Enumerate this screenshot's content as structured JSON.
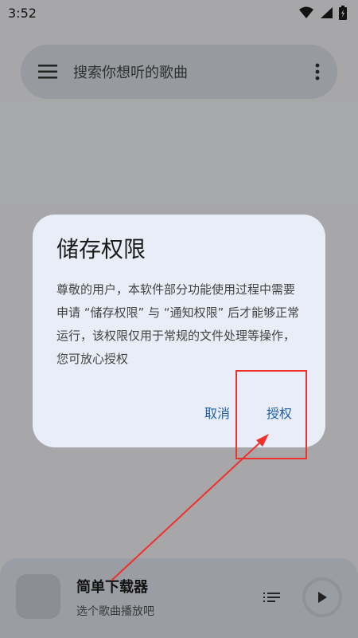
{
  "status_bar": {
    "time": "3:52"
  },
  "search": {
    "placeholder": "搜索你想听的歌曲"
  },
  "dialog": {
    "title": "储存权限",
    "body": "尊敬的用户，本软件部分功能使用过程中需要申请 “储存权限” 与 “通知权限” 后才能够正常运行，该权限仅用于常规的文件处理等操作，您可放心授权",
    "cancel_label": "取消",
    "confirm_label": "授权"
  },
  "player": {
    "title": "简单下载器",
    "subtitle": "选个歌曲播放吧"
  },
  "colors": {
    "accent": "#1f5fa6",
    "annotation": "#f0302a"
  }
}
